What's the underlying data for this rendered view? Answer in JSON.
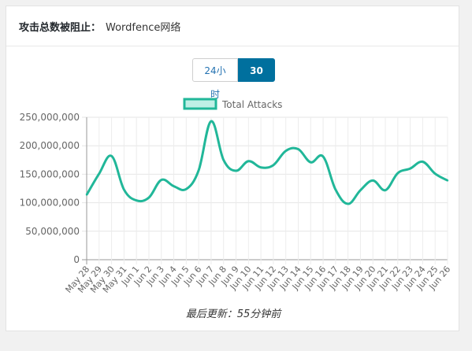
{
  "header": {
    "label": "攻击总数被阻止：",
    "value": "Wordfence网络"
  },
  "toggle": {
    "option_24h": "24小时",
    "option_30d": "30天",
    "selected": "30天"
  },
  "footer": {
    "updated": "最后更新：55分钟前"
  },
  "colors": {
    "series_line": "#21b799",
    "series_fill": "#bff0e6",
    "active_button": "#00709e"
  },
  "chart_data": {
    "type": "line",
    "legend": {
      "labels": [
        "Total Attacks"
      ],
      "placement": "top-center"
    },
    "grid": true,
    "ylim": [
      0,
      250000000
    ],
    "yticks": [
      "0",
      "50,000,000",
      "100,000,000",
      "150,000,000",
      "200,000,000",
      "250,000,000"
    ],
    "categories": [
      "May 28",
      "May 29",
      "May 30",
      "May 31",
      "Jun 1",
      "Jun 2",
      "Jun 3",
      "Jun 4",
      "Jun 5",
      "Jun 6",
      "Jun 7",
      "Jun 8",
      "Jun 9",
      "Jun 10",
      "Jun 11",
      "Jun 12",
      "Jun 13",
      "Jun 14",
      "Jun 15",
      "Jun 16",
      "Jun 17",
      "Jun 18",
      "Jun 19",
      "Jun 20",
      "Jun 21",
      "Jun 22",
      "Jun 23",
      "Jun 24",
      "Jun 25",
      "Jun 26"
    ],
    "series": [
      {
        "name": "Total Attacks",
        "values": [
          114000000,
          151000000,
          182000000,
          123000000,
          104000000,
          109000000,
          140000000,
          129000000,
          124000000,
          157000000,
          243000000,
          175000000,
          156000000,
          173000000,
          162000000,
          166000000,
          191000000,
          194000000,
          171000000,
          181000000,
          123000000,
          98000000,
          122000000,
          139000000,
          122000000,
          152000000,
          160000000,
          172000000,
          151000000,
          139000000
        ]
      }
    ]
  }
}
